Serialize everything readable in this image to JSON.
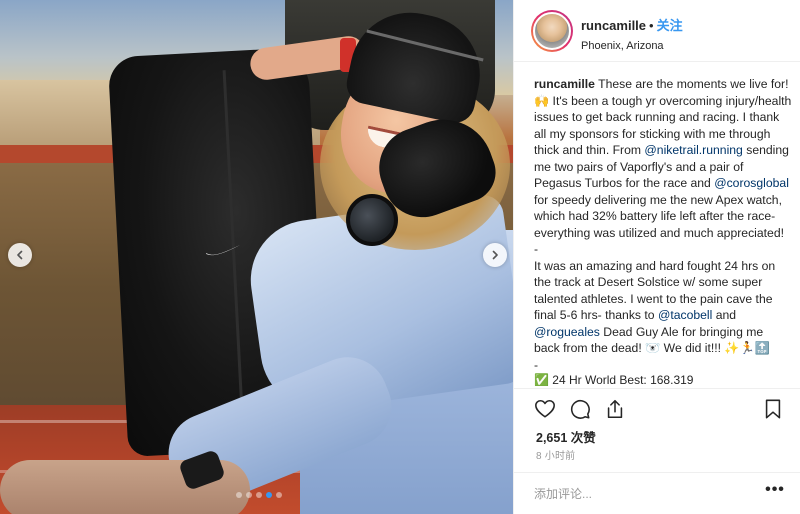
{
  "post": {
    "username": "runcamille",
    "bullet": "•",
    "follow_label": "关注",
    "location": "Phoenix, Arizona"
  },
  "caption": {
    "username": "runcamille",
    "p1_a": " These are the moments we live for! 🙌 It's been a tough yr overcoming injury/health issues to get back running and racing. I thank all my sponsors for sticking with me through thick and thin. From ",
    "mention_1": "@niketrail.running",
    "p1_b": " sending me two pairs of Vaporfly's and a pair of Pegasus Turbos for the race and ",
    "mention_2": "@corosglobal",
    "p1_c": " for speedy delivering me the new Apex watch, which had 32% battery life left after the race- everything was utilized and much appreciated!",
    "dash_1": "-",
    "p2_a": "It was an amazing and hard fought 24 hrs on the track at Desert Solstice w/ some super talented athletes. I went to the pain cave the final 5-6 hrs- thanks to ",
    "mention_3": "@tacobell",
    "p2_b": " and ",
    "mention_4": "@rogueales",
    "p2_c": " Dead Guy Ale for bringing me back from the dead! 🐻‍❄️ We did it!!! ✨🏃🔝",
    "dash_2": "-",
    "cut_line": "✅ 24 Hr World Best: 168.319"
  },
  "stats": {
    "likes": "2,651 次赞",
    "time": "8 小时前"
  },
  "comment": {
    "placeholder": "添加评论...",
    "more_label": "•••"
  },
  "carousel": {
    "slide_count": 5,
    "active_index": 3
  },
  "colors": {
    "accent": "#3897f0",
    "mention": "#003569",
    "text": "#262626",
    "muted": "#999999"
  }
}
